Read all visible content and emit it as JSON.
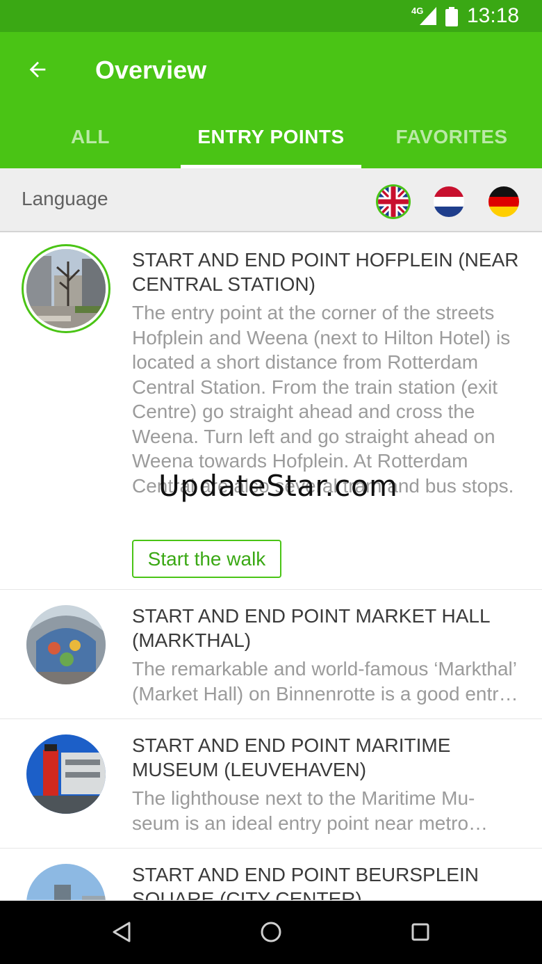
{
  "status_bar": {
    "network": "4G",
    "time": "13:18",
    "signal_icon": "cell-signal-icon",
    "battery_icon": "battery-icon"
  },
  "app_bar": {
    "title": "Overview",
    "back_icon": "arrow-back-icon"
  },
  "tabs": [
    {
      "label": "ALL",
      "active": false
    },
    {
      "label": "ENTRY POINTS",
      "active": true
    },
    {
      "label": "FAVORITES",
      "active": false
    }
  ],
  "language": {
    "label": "Language",
    "flags": [
      "uk-flag",
      "netherlands-flag",
      "germany-flag"
    ],
    "selected": "uk-flag"
  },
  "entries": [
    {
      "title": "START AND END POINT HOFPLEIN (NEAR CENTRAL STATION)",
      "description": "The entry point at the corner of the streets Hofplein and Weena (next to Hilton Hotel) is located a short distance from Rotterdam Central Station. From the train station (exit Centre) go straight ahead and cross the Weena. Turn left and go straight ahead on Weena towards Hofplein. At Rotterdam Central are also several tram and bus stops.",
      "button": "Start the walk"
    },
    {
      "title": "START AND END POINT MARKET HALL (MARKTHAL)",
      "description": "The remarkable and world-famous ‘Markthal’ (Market Hall) on Binnenrotte is a good entry point."
    },
    {
      "title": "START AND END POINT MARITIME MUSEUM (LEUVEHAVEN)",
      "description": "The lighthouse next to the Maritime Mu-seum is an ideal entry point near metro station Leuvehaven."
    },
    {
      "title": "START AND END POINT BEURSPLEIN SQUARE (CITY CENTER)",
      "description": ""
    }
  ],
  "watermark": "UpdateStar.com",
  "nav_bar": {
    "back": "nav-back-icon",
    "home": "nav-home-icon",
    "recents": "nav-recents-icon"
  },
  "colors": {
    "primary": "#4ac415",
    "primary_dark": "#3aa814",
    "title_text": "#3a3a3a",
    "desc_text": "#9b9b9b"
  }
}
